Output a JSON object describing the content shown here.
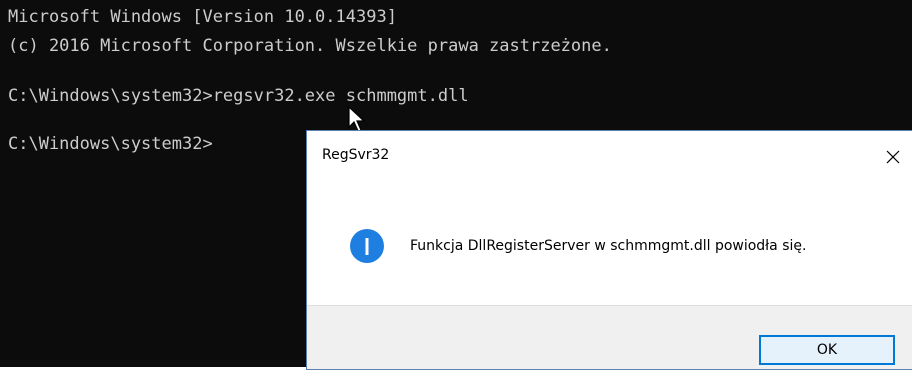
{
  "console": {
    "lines": [
      "Microsoft Windows [Version 10.0.14393]",
      "(c) 2016 Microsoft Corporation. Wszelkie prawa zastrzeżone.",
      "",
      "C:\\Windows\\system32>regsvr32.exe schmmgmt.dll",
      "",
      "C:\\Windows\\system32>"
    ]
  },
  "dialog": {
    "title": "RegSvr32",
    "message": "Funkcja DllRegisterServer w schmmgmt.dll powiodła się.",
    "ok_label": "OK",
    "close_icon": "close-icon",
    "info_icon": "info-icon"
  },
  "colors": {
    "console_bg": "#0c0c0c",
    "console_text": "#cccccc",
    "info_blue": "#1e7fe0",
    "button_accent": "#0078d7"
  }
}
